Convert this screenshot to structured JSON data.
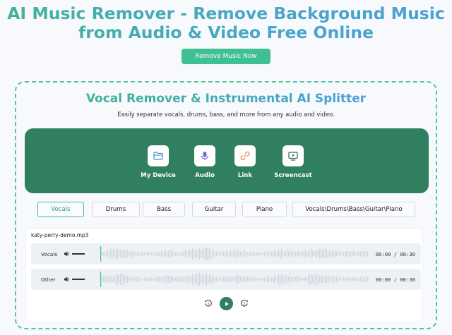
{
  "header": {
    "title_line1": "AI Music Remover - Remove Background Music",
    "title_line2": "from Audio & Video Free Online",
    "cta_label": "Remove Music Now"
  },
  "panel": {
    "title": "Vocal Remover & Instrumental AI Splitter",
    "subtitle": "Easily separate vocals, drums, bass, and more from any audio and video.",
    "sources": [
      {
        "label": "My Device",
        "icon": "folder-icon"
      },
      {
        "label": "Audio",
        "icon": "microphone-icon"
      },
      {
        "label": "Link",
        "icon": "link-icon"
      },
      {
        "label": "Screencast",
        "icon": "monitor-icon"
      }
    ],
    "tabs": [
      {
        "label": "Vocals",
        "active": true
      },
      {
        "label": "Drums",
        "active": false
      },
      {
        "label": "Bass",
        "active": false
      },
      {
        "label": "Guitar",
        "active": false
      },
      {
        "label": "Piano",
        "active": false
      },
      {
        "label": "Vocals\\Drums\\Bass\\Guitar\\Piano",
        "active": false
      }
    ]
  },
  "player": {
    "filename": "katy-perry-demo.mp3",
    "tracks": [
      {
        "name": "Vocals",
        "current": "00:00",
        "separator": "/",
        "total": "00:30"
      },
      {
        "name": "Other",
        "current": "00:00",
        "separator": "/",
        "total": "00:30"
      }
    ],
    "controls": [
      "rewind-5-icon",
      "play-icon",
      "forward-5-icon"
    ]
  },
  "colors": {
    "accent": "#3fbf94",
    "uploader_bg": "#2f7f60",
    "title_gradient_start": "#3fb39a",
    "title_gradient_end": "#4a9fd6"
  }
}
